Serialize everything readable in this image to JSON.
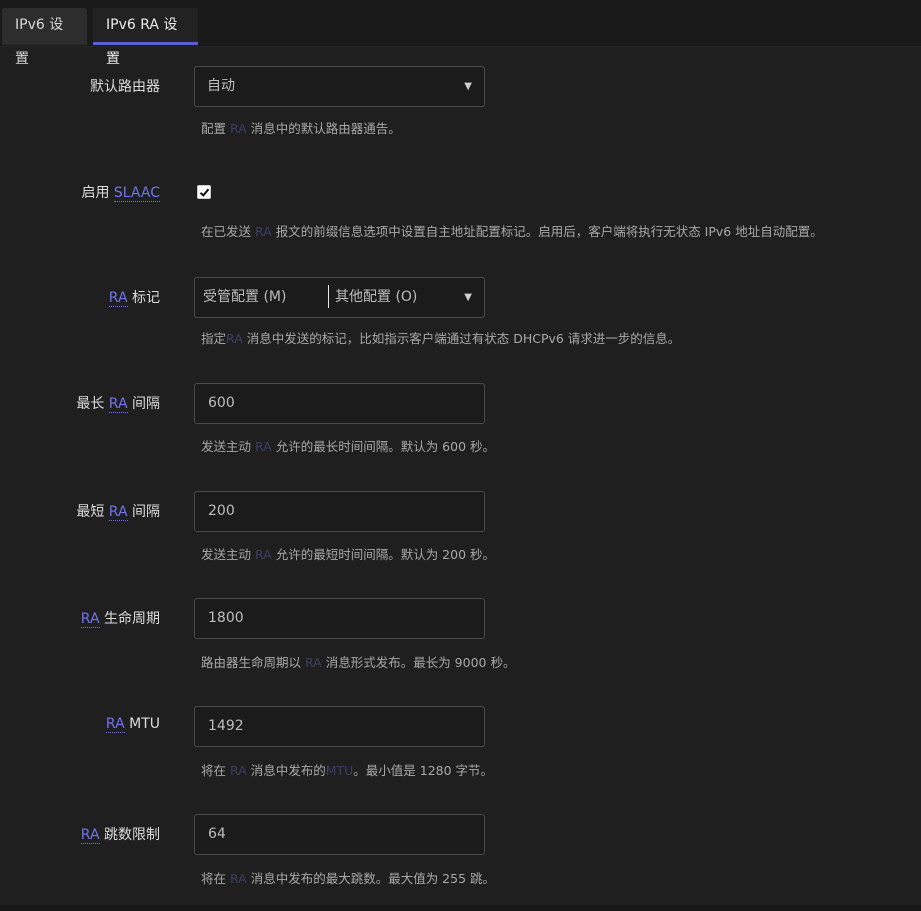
{
  "tabs": [
    {
      "label": "IPv6 设置",
      "active": false
    },
    {
      "label": "IPv6 RA 设置",
      "active": true
    }
  ],
  "accent_color": "#5b5fd6",
  "fields": {
    "default_router": {
      "label": "默认路由器",
      "value": "自动",
      "help_prefix": "配置 ",
      "help_abbr": "RA",
      "help_suffix": " 消息中的默认路由器通告。"
    },
    "slaac": {
      "label_prefix": "启用 ",
      "label_abbr": "SLAAC",
      "checked": true,
      "help_prefix": "在已发送 ",
      "help_abbr": "RA",
      "help_suffix": " 报文的前缀信息选项中设置自主地址配置标记。启用后，客户端将执行无状态 IPv6 地址自动配置。"
    },
    "ra_flags": {
      "label_abbr": "RA",
      "label_suffix": " 标记",
      "values": [
        "受管配置 (M)",
        "其他配置 (O)"
      ],
      "help_prefix": "指定",
      "help_abbr": "RA",
      "help_suffix": " 消息中发送的标记，比如指示客户端通过有状态 DHCPv6 请求进一步的信息。"
    },
    "max_interval": {
      "label_prefix": "最长 ",
      "label_abbr": "RA",
      "label_suffix": " 间隔",
      "value": "600",
      "help_prefix": "发送主动 ",
      "help_abbr": "RA",
      "help_suffix": " 允许的最长时间间隔。默认为 600 秒。"
    },
    "min_interval": {
      "label_prefix": "最短 ",
      "label_abbr": "RA",
      "label_suffix": " 间隔",
      "value": "200",
      "help_prefix": "发送主动 ",
      "help_abbr": "RA",
      "help_suffix": " 允许的最短时间间隔。默认为 200 秒。"
    },
    "lifetime": {
      "label_abbr": "RA",
      "label_suffix": " 生命周期",
      "value": "1800",
      "help_prefix": "路由器生命周期以 ",
      "help_abbr": "RA",
      "help_suffix": " 消息形式发布。最长为 9000 秒。"
    },
    "mtu": {
      "label_abbr": "RA",
      "label_suffix": " MTU",
      "value": "1492",
      "help_prefix": "将在 ",
      "help_abbr": "RA",
      "help_mid": " 消息中发布的",
      "help_abbr2": "MTU",
      "help_suffix": "。最小值是 1280 字节。"
    },
    "hop_limit": {
      "label_abbr": "RA",
      "label_suffix": " 跳数限制",
      "value": "64",
      "help_prefix": "将在 ",
      "help_abbr": "RA",
      "help_suffix": " 消息中发布的最大跳数。最大值为 255 跳。"
    }
  }
}
